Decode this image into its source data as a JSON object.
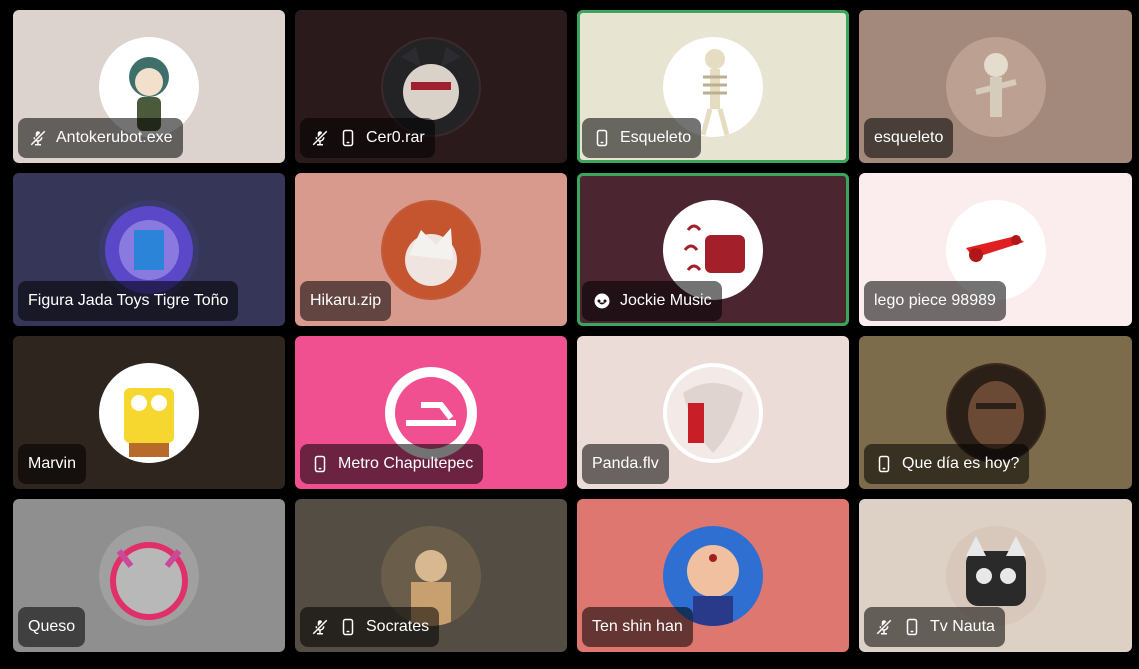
{
  "tiles": [
    {
      "name": "Antokerubot.exe",
      "bg": "#dcd2ce",
      "avatar_bg": "#ffffff",
      "icons": [
        "mic-muted-icon"
      ],
      "speaking": false
    },
    {
      "name": "Cer0.rar",
      "bg": "#2a1a1c",
      "avatar_bg": "#3a2a2c",
      "icons": [
        "mic-muted-icon",
        "phone-icon"
      ],
      "speaking": false
    },
    {
      "name": "Esqueleto",
      "bg": "#e7e4d2",
      "avatar_bg": "#ffffff",
      "icons": [
        "phone-icon"
      ],
      "speaking": true
    },
    {
      "name": "esqueleto",
      "bg": "#a3897c",
      "avatar_bg": "#bca092",
      "icons": [],
      "speaking": false
    },
    {
      "name": "Figura Jada Toys Tigre Toño",
      "bg": "#363758",
      "avatar_bg": "#3a3a6a",
      "icons": [],
      "speaking": false
    },
    {
      "name": "Hikaru.zip",
      "bg": "#d99a8e",
      "avatar_bg": "#c45a3a",
      "icons": [],
      "speaking": false
    },
    {
      "name": "Jockie Music",
      "bg": "#4b2631",
      "avatar_bg": "#ffffff",
      "icons": [
        "activity-icon"
      ],
      "speaking": true
    },
    {
      "name": "lego piece 98989",
      "bg": "#fbeced",
      "avatar_bg": "#ffffff",
      "icons": [],
      "speaking": false
    },
    {
      "name": "Marvin",
      "bg": "#2f251f",
      "avatar_bg": "#ffffff",
      "icons": [],
      "speaking": false
    },
    {
      "name": "Metro Chapultepec",
      "bg": "#f04f90",
      "avatar_bg": "#f04f90",
      "icons": [
        "phone-icon"
      ],
      "speaking": false
    },
    {
      "name": "Panda.flv",
      "bg": "#ecdcd8",
      "avatar_bg": "#ffffff",
      "icons": [],
      "speaking": false
    },
    {
      "name": "Que día es hoy?",
      "bg": "#7d6c4b",
      "avatar_bg": "#3a2a1e",
      "icons": [
        "phone-icon"
      ],
      "speaking": false
    },
    {
      "name": "Queso",
      "bg": "#8f8f8f",
      "avatar_bg": "#a0a0a0",
      "icons": [],
      "speaking": false
    },
    {
      "name": "Socrates",
      "bg": "#544d43",
      "avatar_bg": "#6a5d4a",
      "icons": [
        "mic-muted-icon",
        "phone-icon"
      ],
      "speaking": false
    },
    {
      "name": "Ten shin han",
      "bg": "#df7771",
      "avatar_bg": "#2f6fd1",
      "icons": [],
      "speaking": false
    },
    {
      "name": "Tv Nauta",
      "bg": "#ddd1c6",
      "avatar_bg": "#d8c8bc",
      "icons": [
        "mic-muted-icon",
        "phone-icon"
      ],
      "speaking": false
    }
  ],
  "colors": {
    "speaking_border": "#3ba55c",
    "label_bg": "rgba(0,0,0,0.55)",
    "background": "#000000"
  }
}
